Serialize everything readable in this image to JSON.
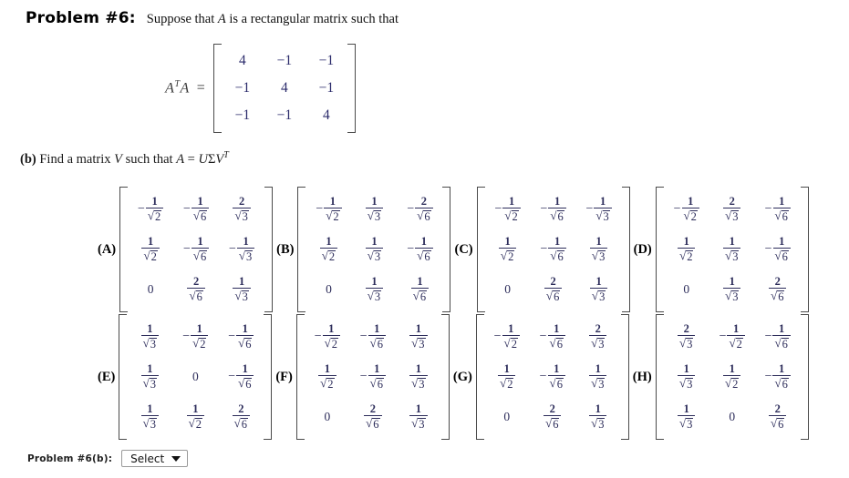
{
  "header": {
    "problem_label": "Problem #6:",
    "statement_pre": "Suppose that ",
    "statement_var": "A",
    "statement_post": " is a rectangular matrix such that"
  },
  "equation": {
    "lhs_base": "A",
    "lhs_sup": "T",
    "lhs_base2": "A",
    "equals": "=",
    "matrix": [
      [
        "4",
        "−1",
        "−1"
      ],
      [
        "−1",
        "4",
        "−1"
      ],
      [
        "−1",
        "−1",
        "4"
      ]
    ]
  },
  "part_b": {
    "label": "(b)",
    "text_pre": "Find a matrix ",
    "var_v": "V",
    "text_mid": " such that ",
    "var_a": "A",
    "equals": "=",
    "rhs_u": "U",
    "rhs_sigma": "Σ",
    "rhs_v": "V",
    "rhs_sup": "T"
  },
  "choices": [
    {
      "label": "(A)",
      "cells": [
        [
          {
            "sign": "-",
            "num": "1",
            "root": "2"
          },
          {
            "sign": "-",
            "num": "1",
            "root": "6"
          },
          {
            "sign": "",
            "num": "2",
            "root": "3"
          }
        ],
        [
          {
            "sign": "",
            "num": "1",
            "root": "2"
          },
          {
            "sign": "-",
            "num": "1",
            "root": "6"
          },
          {
            "sign": "-",
            "num": "1",
            "root": "3"
          }
        ],
        [
          {
            "zero": "0"
          },
          {
            "sign": "",
            "num": "2",
            "root": "6"
          },
          {
            "sign": "",
            "num": "1",
            "root": "3"
          }
        ]
      ]
    },
    {
      "label": "(B)",
      "cells": [
        [
          {
            "sign": "-",
            "num": "1",
            "root": "2"
          },
          {
            "sign": "",
            "num": "1",
            "root": "3"
          },
          {
            "sign": "-",
            "num": "2",
            "root": "6"
          }
        ],
        [
          {
            "sign": "",
            "num": "1",
            "root": "2"
          },
          {
            "sign": "",
            "num": "1",
            "root": "3"
          },
          {
            "sign": "-",
            "num": "1",
            "root": "6"
          }
        ],
        [
          {
            "zero": "0"
          },
          {
            "sign": "",
            "num": "1",
            "root": "3"
          },
          {
            "sign": "",
            "num": "1",
            "root": "6"
          }
        ]
      ]
    },
    {
      "label": "(C)",
      "cells": [
        [
          {
            "sign": "-",
            "num": "1",
            "root": "2"
          },
          {
            "sign": "-",
            "num": "1",
            "root": "6"
          },
          {
            "sign": "-",
            "num": "1",
            "root": "3"
          }
        ],
        [
          {
            "sign": "",
            "num": "1",
            "root": "2"
          },
          {
            "sign": "-",
            "num": "1",
            "root": "6"
          },
          {
            "sign": "",
            "num": "1",
            "root": "3"
          }
        ],
        [
          {
            "zero": "0"
          },
          {
            "sign": "",
            "num": "2",
            "root": "6"
          },
          {
            "sign": "",
            "num": "1",
            "root": "3"
          }
        ]
      ]
    },
    {
      "label": "(D)",
      "cells": [
        [
          {
            "sign": "-",
            "num": "1",
            "root": "2"
          },
          {
            "sign": "",
            "num": "2",
            "root": "3"
          },
          {
            "sign": "-",
            "num": "1",
            "root": "6"
          }
        ],
        [
          {
            "sign": "",
            "num": "1",
            "root": "2"
          },
          {
            "sign": "",
            "num": "1",
            "root": "3"
          },
          {
            "sign": "-",
            "num": "1",
            "root": "6"
          }
        ],
        [
          {
            "zero": "0"
          },
          {
            "sign": "",
            "num": "1",
            "root": "3"
          },
          {
            "sign": "",
            "num": "2",
            "root": "6"
          }
        ]
      ]
    },
    {
      "label": "(E)",
      "cells": [
        [
          {
            "sign": "",
            "num": "1",
            "root": "3"
          },
          {
            "sign": "-",
            "num": "1",
            "root": "2"
          },
          {
            "sign": "-",
            "num": "1",
            "root": "6"
          }
        ],
        [
          {
            "sign": "",
            "num": "1",
            "root": "3"
          },
          {
            "zero": "0"
          },
          {
            "sign": "-",
            "num": "1",
            "root": "6"
          }
        ],
        [
          {
            "sign": "",
            "num": "1",
            "root": "3"
          },
          {
            "sign": "",
            "num": "1",
            "root": "2"
          },
          {
            "sign": "",
            "num": "2",
            "root": "6"
          }
        ]
      ]
    },
    {
      "label": "(F)",
      "cells": [
        [
          {
            "sign": "-",
            "num": "1",
            "root": "2"
          },
          {
            "sign": "-",
            "num": "1",
            "root": "6"
          },
          {
            "sign": "",
            "num": "1",
            "root": "3"
          }
        ],
        [
          {
            "sign": "",
            "num": "1",
            "root": "2"
          },
          {
            "sign": "-",
            "num": "1",
            "root": "6"
          },
          {
            "sign": "",
            "num": "1",
            "root": "3"
          }
        ],
        [
          {
            "zero": "0"
          },
          {
            "sign": "",
            "num": "2",
            "root": "6"
          },
          {
            "sign": "",
            "num": "1",
            "root": "3"
          }
        ]
      ]
    },
    {
      "label": "(G)",
      "cells": [
        [
          {
            "sign": "-",
            "num": "1",
            "root": "2"
          },
          {
            "sign": "-",
            "num": "1",
            "root": "6"
          },
          {
            "sign": "",
            "num": "2",
            "root": "3"
          }
        ],
        [
          {
            "sign": "",
            "num": "1",
            "root": "2"
          },
          {
            "sign": "-",
            "num": "1",
            "root": "6"
          },
          {
            "sign": "",
            "num": "1",
            "root": "3"
          }
        ],
        [
          {
            "zero": "0"
          },
          {
            "sign": "",
            "num": "2",
            "root": "6"
          },
          {
            "sign": "",
            "num": "1",
            "root": "3"
          }
        ]
      ]
    },
    {
      "label": "(H)",
      "cells": [
        [
          {
            "sign": "",
            "num": "2",
            "root": "3"
          },
          {
            "sign": "-",
            "num": "1",
            "root": "2"
          },
          {
            "sign": "-",
            "num": "1",
            "root": "6"
          }
        ],
        [
          {
            "sign": "",
            "num": "1",
            "root": "3"
          },
          {
            "sign": "",
            "num": "1",
            "root": "2"
          },
          {
            "sign": "-",
            "num": "1",
            "root": "6"
          }
        ],
        [
          {
            "sign": "",
            "num": "1",
            "root": "3"
          },
          {
            "zero": "0"
          },
          {
            "sign": "",
            "num": "2",
            "root": "6"
          }
        ]
      ]
    }
  ],
  "footer": {
    "label": "Problem #6(b):",
    "select_value": "Select"
  },
  "colors": {
    "math_blue": "#2c2c5a",
    "text": "#111111",
    "bracket": "#4a4a4a"
  }
}
